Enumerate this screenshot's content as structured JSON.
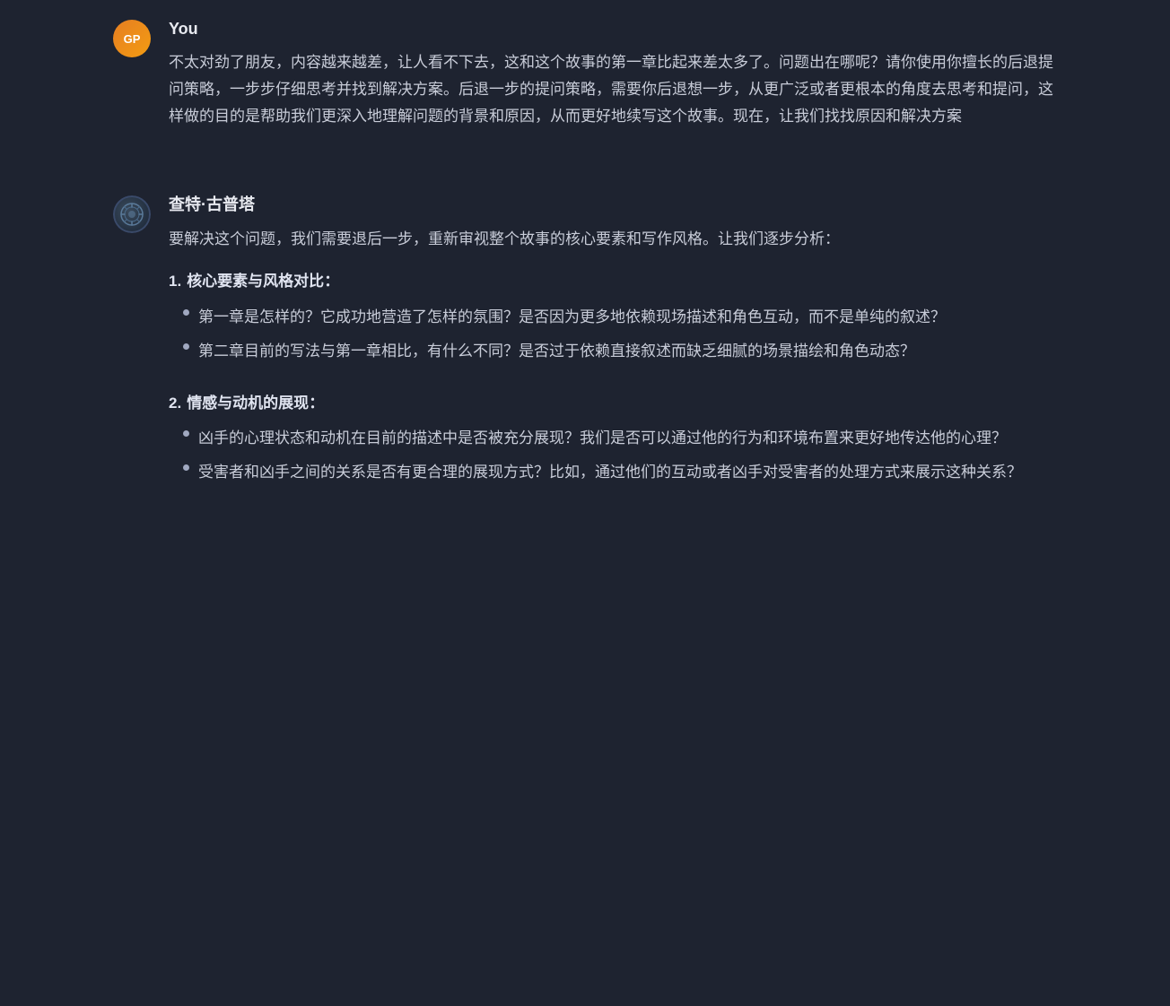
{
  "theme": {
    "background": "#1e2330",
    "text_primary": "#c8ccd8",
    "text_heading": "#e8eaf0",
    "text_bold": "#e0e4f0",
    "accent": "#e67e22"
  },
  "messages": [
    {
      "id": "user-message",
      "sender": "You",
      "avatar_label": "GP",
      "avatar_type": "user",
      "text": "不太对劲了朋友，内容越来越差，让人看不下去，这和这个故事的第一章比起来差太多了。问题出在哪呢？请你使用你擅长的后退提问策略，一步步仔细思考并找到解决方案。后退一步的提问策略，需要你后退想一步，从更广泛或者更根本的角度去思考和提问，这样做的目的是帮助我们更深入地理解问题的背景和原因，从而更好地续写这个故事。现在，让我们找找原因和解决方案"
    },
    {
      "id": "ai-message",
      "sender": "查特·古普塔",
      "avatar_type": "ai",
      "intro": "要解决这个问题，我们需要退后一步，重新审视整个故事的核心要素和写作风格。让我们逐步分析：",
      "sections": [
        {
          "number": "1.",
          "title": "核心要素与风格对比",
          "title_suffix": "：",
          "bullets": [
            "第一章是怎样的？它成功地营造了怎样的氛围？是否因为更多地依赖现场描述和角色互动，而不是单纯的叙述？",
            "第二章目前的写法与第一章相比，有什么不同？是否过于依赖直接叙述而缺乏细腻的场景描绘和角色动态？"
          ]
        },
        {
          "number": "2.",
          "title": "情感与动机的展现",
          "title_suffix": "：",
          "bullets": [
            "凶手的心理状态和动机在目前的描述中是否被充分展现？我们是否可以通过他的行为和环境布置来更好地传达他的心理？",
            "受害者和凶手之间的关系是否有更合理的展现方式？比如，通过他们的互动或者凶手对受害者的处理方式来展示这种关系？"
          ]
        }
      ]
    }
  ]
}
